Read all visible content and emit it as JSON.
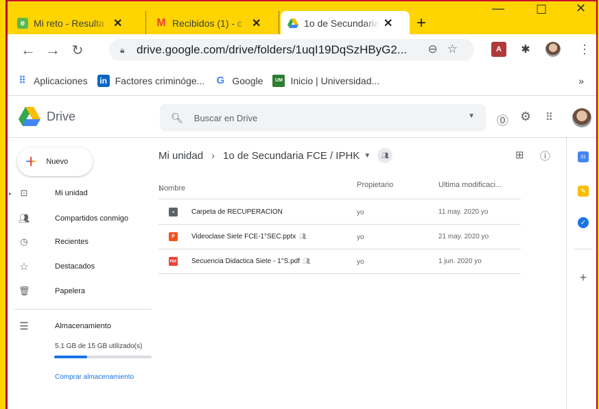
{
  "browser": {
    "tabs": [
      {
        "label": "Mi reto - Resulta",
        "icon": "edmodo-icon",
        "color": "#5bb84f"
      },
      {
        "label": "Recibidos (1) - c",
        "icon": "gmail-icon",
        "color": "#ea4335"
      },
      {
        "label": "1o de Secundaria",
        "icon": "drive-icon",
        "color": "#34a853"
      }
    ],
    "address": "drive.google.com/drive/folders/1uqI19DqSzHByG2...",
    "bookmarks": [
      {
        "label": "Aplicaciones",
        "icon": "apps-grid-icon"
      },
      {
        "label": "Factores criminóge...",
        "icon": "linkedin-icon"
      },
      {
        "label": "Google",
        "icon": "google-icon"
      },
      {
        "label": "Inicio | Universidad...",
        "icon": "university-icon"
      }
    ],
    "more_bookmarks": "»"
  },
  "drive": {
    "logo_label": "Drive",
    "search_placeholder": "Buscar en Drive",
    "new_label": "Nuevo",
    "nav": [
      {
        "label": "Mi unidad",
        "icon": "my-drive-icon"
      },
      {
        "label": "Compartidos conmigo",
        "icon": "shared-icon"
      },
      {
        "label": "Recientes",
        "icon": "clock-icon"
      },
      {
        "label": "Destacados",
        "icon": "star-icon"
      },
      {
        "label": "Papelera",
        "icon": "trash-icon"
      }
    ],
    "storage_label": "Almacenamiento",
    "storage_text": "5.1 GB de 15 GB utilizado(s)",
    "storage_fraction": 0.34,
    "buy_storage": "Comprar almacenamiento",
    "breadcrumb": {
      "root": "Mi unidad",
      "current": "1o de Secundaria FCE / IPHK"
    },
    "columns": {
      "name": "Nombre",
      "owner": "Propietario",
      "modified": "Ultima modificaci..."
    },
    "files": [
      {
        "name": "Carpeta de RECUPERACION",
        "type": "folder",
        "shared": false,
        "owner": "yo",
        "modified": "11 may. 2020 yo",
        "color": "#5f6368",
        "badge": ""
      },
      {
        "name": "Videoclase Siete FCE-1°SEC.pptx",
        "type": "pptx",
        "shared": true,
        "owner": "yo",
        "modified": "21 may. 2020 yo",
        "color": "#f4511e",
        "badge": "P"
      },
      {
        "name": "Secuencia Didactica Siete - 1°S.pdf",
        "type": "pdf",
        "shared": true,
        "owner": "yo",
        "modified": "1 jun. 2020 yo",
        "color": "#ea4335",
        "badge": "PDF"
      }
    ]
  }
}
